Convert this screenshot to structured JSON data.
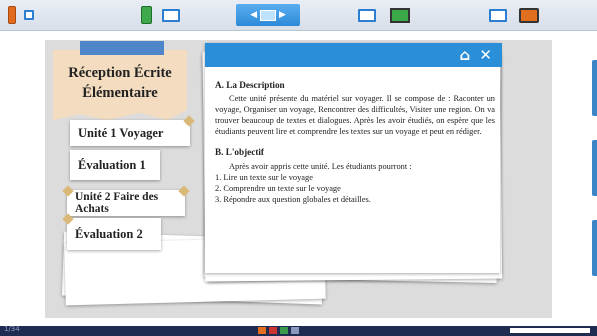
{
  "toolbar": {
    "buttons": [
      {
        "name": "orange-phone-view"
      },
      {
        "name": "green-phone-view"
      },
      {
        "name": "desktop-view",
        "active": true
      },
      {
        "name": "green-screen-view"
      },
      {
        "name": "orange-screen-view"
      }
    ],
    "accent_color": "#2a8ed8"
  },
  "sidebar": {
    "title_line1": "Réception Écrite",
    "title_line2": "Élémentaire",
    "items": [
      {
        "label": "Unité 1 Voyager"
      },
      {
        "label": "Évaluation 1"
      },
      {
        "label": "Unité 2 Faire des Achats"
      },
      {
        "label": "Évaluation 2"
      }
    ]
  },
  "header": {
    "home_icon": "⌂",
    "close_icon": "✕"
  },
  "content": {
    "section_a_title": "A.  La Description",
    "section_a_body": "Cette unité présente du matériel sur voyager. Il se compose de : Raconter un voyage, Organiser un voyage, Rencontrer des difficultés, Visiter une region. On va trouver beaucoup de textes et dialogues. Après les avoir étudiés, on espère que les étudiants peuvent lire et comprendre les textes sur un voyage et peut en rédiger.",
    "section_b_title": "B. L'objectif",
    "section_b_intro": "Après avoir appris cette unité. Les étudiants pourront :",
    "objectives": [
      "1. Lire un texte sur le voyage",
      "2. Comprendre un texte sur le voyage",
      "3. Répondre aux question globales et détailles."
    ]
  },
  "statusbar": {
    "text": "1/34"
  }
}
